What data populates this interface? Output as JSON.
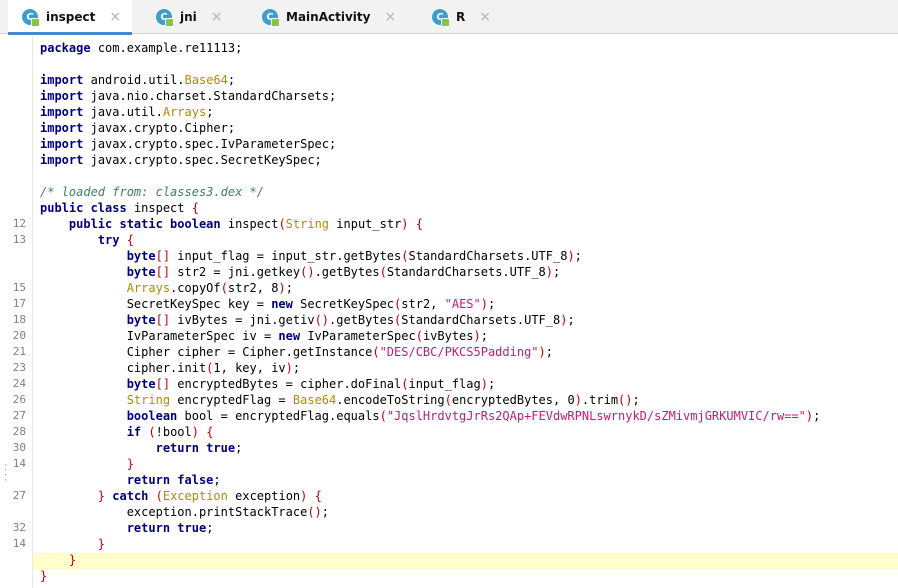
{
  "tabs": [
    {
      "label": "inspect",
      "icon": "class-icon",
      "active": true
    },
    {
      "label": "jni",
      "icon": "class-icon",
      "active": false
    },
    {
      "label": "MainActivity",
      "icon": "class-icon",
      "active": false
    },
    {
      "label": "R",
      "icon": "class-icon",
      "active": false
    }
  ],
  "tab_icon_letter": "C",
  "close_glyph": "×",
  "code": {
    "package": "com.example.re11113;",
    "imports": [
      "android.util.",
      "Base64",
      "java.nio.charset.StandardCharsets;",
      "java.util.",
      "Arrays",
      "javax.crypto.Cipher;",
      "javax.crypto.spec.IvParameterSpec;",
      "javax.crypto.spec.SecretKeySpec;"
    ],
    "comment": "/* loaded from: classes3.dex */",
    "class_name": "inspect",
    "method_sig_name": "inspect",
    "param_type": "String",
    "param_name": "input_str",
    "aes": "\"AES\"",
    "cipher_mode": "\"DES/CBC/PKCS5Padding\"",
    "encrypted_literal": "\"JqslHrdvtgJrRs2QAp+FEVdwRPNLswrnykD/sZMivmjGRKUMVIC/rw==\"",
    "exception_type": "Exception",
    "exception_var": "exception"
  },
  "line_numbers": [
    {
      "n": "12",
      "row": 11
    },
    {
      "n": "13",
      "row": 12
    },
    {
      "n": "15",
      "row": 15
    },
    {
      "n": "17",
      "row": 16
    },
    {
      "n": "18",
      "row": 17
    },
    {
      "n": "20",
      "row": 18
    },
    {
      "n": "21",
      "row": 19
    },
    {
      "n": "23",
      "row": 20
    },
    {
      "n": "24",
      "row": 21
    },
    {
      "n": "26",
      "row": 22
    },
    {
      "n": "27",
      "row": 23
    },
    {
      "n": "28",
      "row": 24
    },
    {
      "n": "30",
      "row": 25
    },
    {
      "n": "14",
      "row": 26
    },
    {
      "n": "27",
      "row": 28
    },
    {
      "n": "32",
      "row": 30
    },
    {
      "n": "14",
      "row": 31
    }
  ],
  "colors": {
    "keyword": "#00007f",
    "string": "#c4197e",
    "comment": "#3f7f5f",
    "brace": "#c00000",
    "highlight": "#ffffcc",
    "tab_accent": "#4a86c8"
  }
}
